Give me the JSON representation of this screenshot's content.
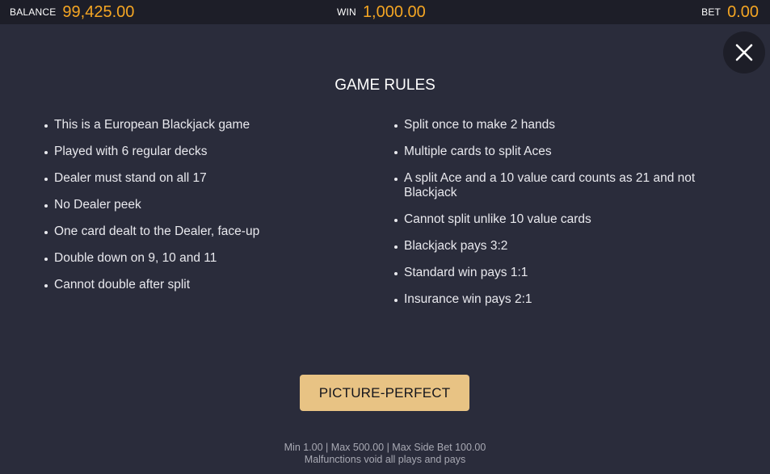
{
  "topbar": {
    "balance_label": "BALANCE",
    "balance_value": "99,425.00",
    "win_label": "WIN",
    "win_value": "1,000.00",
    "bet_label": "BET",
    "bet_value": "0.00"
  },
  "close_icon": "close-icon",
  "rules": {
    "title": "GAME RULES",
    "left": [
      "This is a European Blackjack game",
      "Played with 6 regular decks",
      "Dealer must stand on all 17",
      "No Dealer peek",
      "One card dealt to the Dealer, face-up",
      "Double down on 9, 10 and 11",
      "Cannot double after split"
    ],
    "right": [
      "Split once to make 2 hands",
      "Multiple cards to split Aces",
      "A split Ace and a 10 value card counts as 21 and not Blackjack",
      "Cannot split unlike 10 value cards",
      "Blackjack pays 3:2",
      "Standard win pays 1:1",
      "Insurance win pays 2:1"
    ]
  },
  "button": {
    "label": "PICTURE-PERFECT"
  },
  "footer": {
    "limits": "Min 1.00 | Max 500.00 | Max Side Bet 100.00",
    "disclaimer": "Malfunctions void all plays and pays"
  },
  "colors": {
    "background": "#2a2c3b",
    "topbar": "#1d1e28",
    "accent_value": "#f5a623",
    "button": "#e8c384"
  }
}
